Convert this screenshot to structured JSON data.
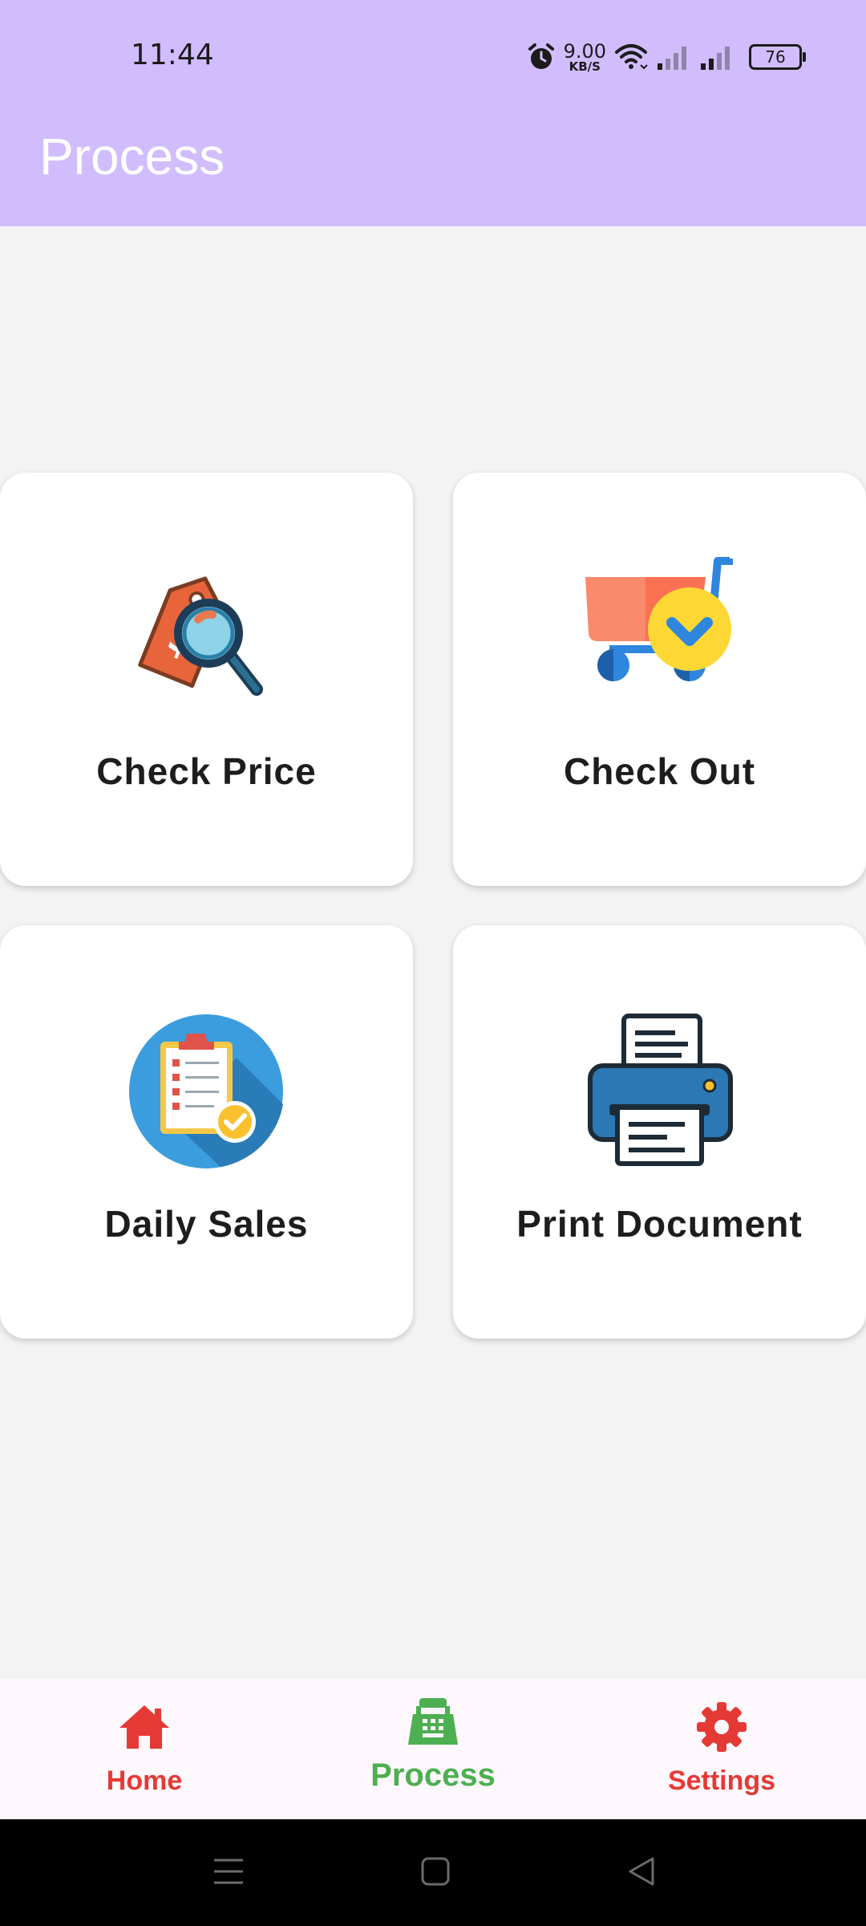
{
  "status_bar": {
    "time": "11:44",
    "net_speed_value": "9.00",
    "net_speed_unit": "KB/S",
    "battery": "76",
    "icons": [
      "alarm-icon",
      "wifi-icon",
      "signal-icon",
      "signal-icon",
      "battery-icon"
    ]
  },
  "app_bar": {
    "title": "Process",
    "color": "#d1bdfd"
  },
  "cards": [
    {
      "label": "Check Price",
      "icon": "price-tag-magnifier-icon"
    },
    {
      "label": "Check Out",
      "icon": "shopping-cart-icon"
    },
    {
      "label": "Daily Sales",
      "icon": "clipboard-checklist-icon"
    },
    {
      "label": "Print Document",
      "icon": "printer-icon"
    }
  ],
  "bottom_nav": {
    "items": [
      {
        "label": "Home",
        "icon": "home-icon",
        "color": "#e53935",
        "selected": false
      },
      {
        "label": "Process",
        "icon": "cash-register-icon",
        "color": "#4caf50",
        "selected": true
      },
      {
        "label": "Settings",
        "icon": "gear-icon",
        "color": "#e53935",
        "selected": false
      }
    ]
  },
  "system_nav": {
    "icons": [
      "menu-icon",
      "home-square-icon",
      "back-triangle-icon"
    ]
  }
}
